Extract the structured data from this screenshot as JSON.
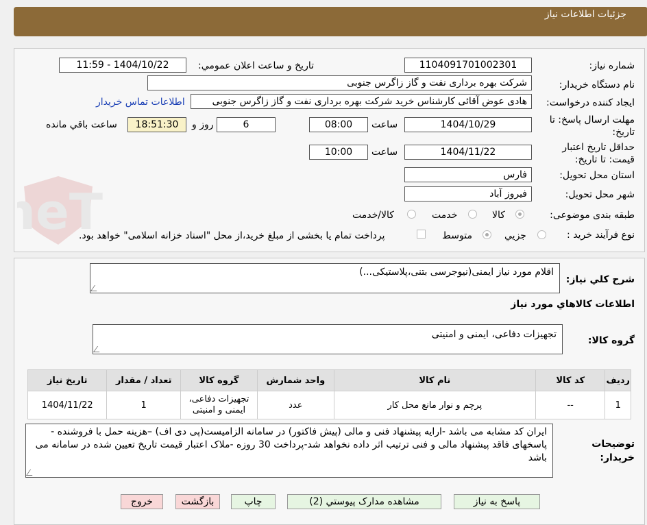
{
  "header": {
    "title": "جزئیات اطلاعات نیاز"
  },
  "form": {
    "need_number_label": "شماره نیاز:",
    "need_number": "1104091701002301",
    "announce_label": "تاریخ و ساعت اعلان عمومي:",
    "announce_value": "1404/10/22 - 11:59",
    "buyer_org_label": "نام دستگاه خريدار:",
    "buyer_org": "شرکت بهره برداری نفت و گاز زاگرس جنوبی",
    "requester_label": "ايجاد کننده درخواست:",
    "requester": "هادی عوض آقائی کارشناس خرید شرکت بهره برداری نفت و گاز زاگرس جنوبی",
    "contact_link": "اطلاعات تماس خريدار",
    "deadline_label": "مهلت ارسال پاسخ: تا تاريخ:",
    "deadline_date": "1404/10/29",
    "time_label": "ساعت",
    "deadline_time": "08:00",
    "days_value": "6",
    "days_label": "روز و",
    "remaining_time": "18:51:30",
    "remaining_label": "ساعت باقي مانده",
    "validity_label": "حداقل تاريخ اعتبار قيمت: تا تاريخ:",
    "validity_date": "1404/11/22",
    "validity_time": "10:00",
    "province_label": "استان محل تحويل:",
    "province": "فارس",
    "city_label": "شهر محل تحويل:",
    "city": "فيروز آباد",
    "category_label": "طبقه بندی موضوعی:",
    "category_options": [
      "کالا",
      "خدمت",
      "کالا/خدمت"
    ],
    "purchase_type_label": "نوع فرآيند خريد :",
    "purchase_options": [
      "جزيي",
      "متوسط"
    ],
    "payment_note": "پرداخت تمام يا بخشی از مبلغ خريد،از محل \"اسناد خزانه اسلامی\" خواهد بود."
  },
  "summary": {
    "label": "شرح کلي نياز:",
    "value": "اقلام مورد نیاز ایمنی(نیوجرسی بتنی،پلاستیکی...)",
    "goods_section_title": "اطلاعات کالاهاي مورد نياز",
    "goods_group_label": "گروه کالا:",
    "goods_group_value": "تجهیزات دفاعی، ایمنی و امنیتی"
  },
  "table": {
    "headers": [
      "رديف",
      "کد کالا",
      "نام کالا",
      "واحد شمارش",
      "گروه کالا",
      "تعداد / مقدار",
      "تاريخ نياز"
    ],
    "rows": [
      {
        "row": "1",
        "code": "--",
        "name": "پرچم و نوار مانع محل کار",
        "unit": "عدد",
        "group": "تجهیزات دفاعی، ایمنی و امنیتی",
        "qty": "1",
        "date": "1404/11/22"
      }
    ]
  },
  "buyer_notes": {
    "label": "توضيحات خريدار:",
    "value": "ایران کد مشابه می باشد -ارایه پیشنهاد فنی و مالی (پیش فاکتور) در سامانه الزامیست(پی دی اف) –هزینه حمل با فروشنده - پاسخهای فاقد پیشنهاد مالی و فنی ترتیب اثر داده نخواهد شد-پرداخت 30 روزه -ملاک اعتبار قیمت تاریخ تعیین شده در سامانه می باشد"
  },
  "buttons": {
    "reply": "پاسخ به نياز",
    "attachments": "مشاهده مدارک پيوستي (2)",
    "print": "چاپ",
    "back": "بازگشت",
    "exit": "خروج"
  },
  "watermark": {
    "text": "AriaTender.neT"
  },
  "colors": {
    "header_bg": "#8c6a38",
    "link": "#1a3fb5",
    "remaining_bg": "#f9f2c8"
  }
}
